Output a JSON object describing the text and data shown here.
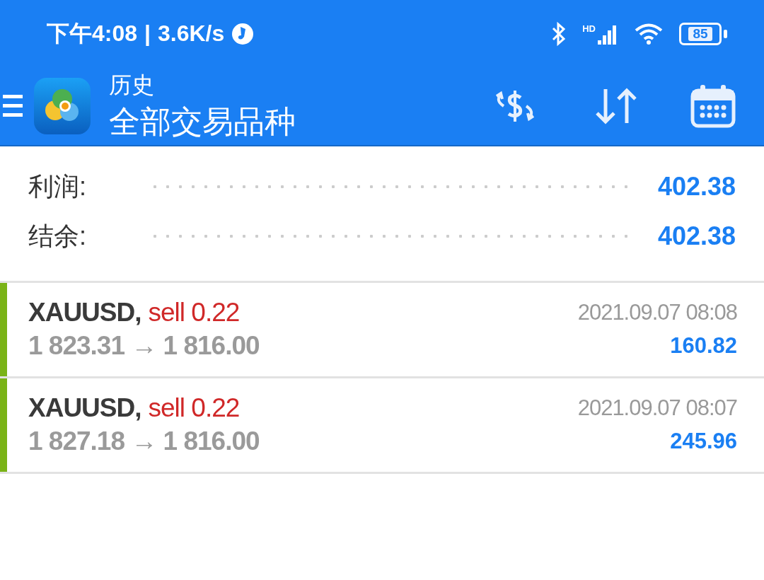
{
  "status_bar": {
    "time": "下午4:08",
    "separator": "|",
    "speed": "3.6K/s",
    "signal_label": "HD",
    "battery": "85"
  },
  "toolbar": {
    "title": "历史",
    "subtitle": "全部交易品种"
  },
  "summary": [
    {
      "label": "利润:",
      "value": "402.38"
    },
    {
      "label": "结余:",
      "value": "402.38"
    }
  ],
  "trades": [
    {
      "symbol": "XAUUSD,",
      "kind": "sell",
      "side": "sell 0.22",
      "prices": "1 823.31 → 1 816.00",
      "time": "2021.09.07 08:08",
      "profit": "160.82"
    },
    {
      "symbol": "XAUUSD,",
      "kind": "sell",
      "side": "sell 0.22",
      "prices": "1 827.18 → 1 816.00",
      "time": "2021.09.07 08:07",
      "profit": "245.96"
    }
  ]
}
